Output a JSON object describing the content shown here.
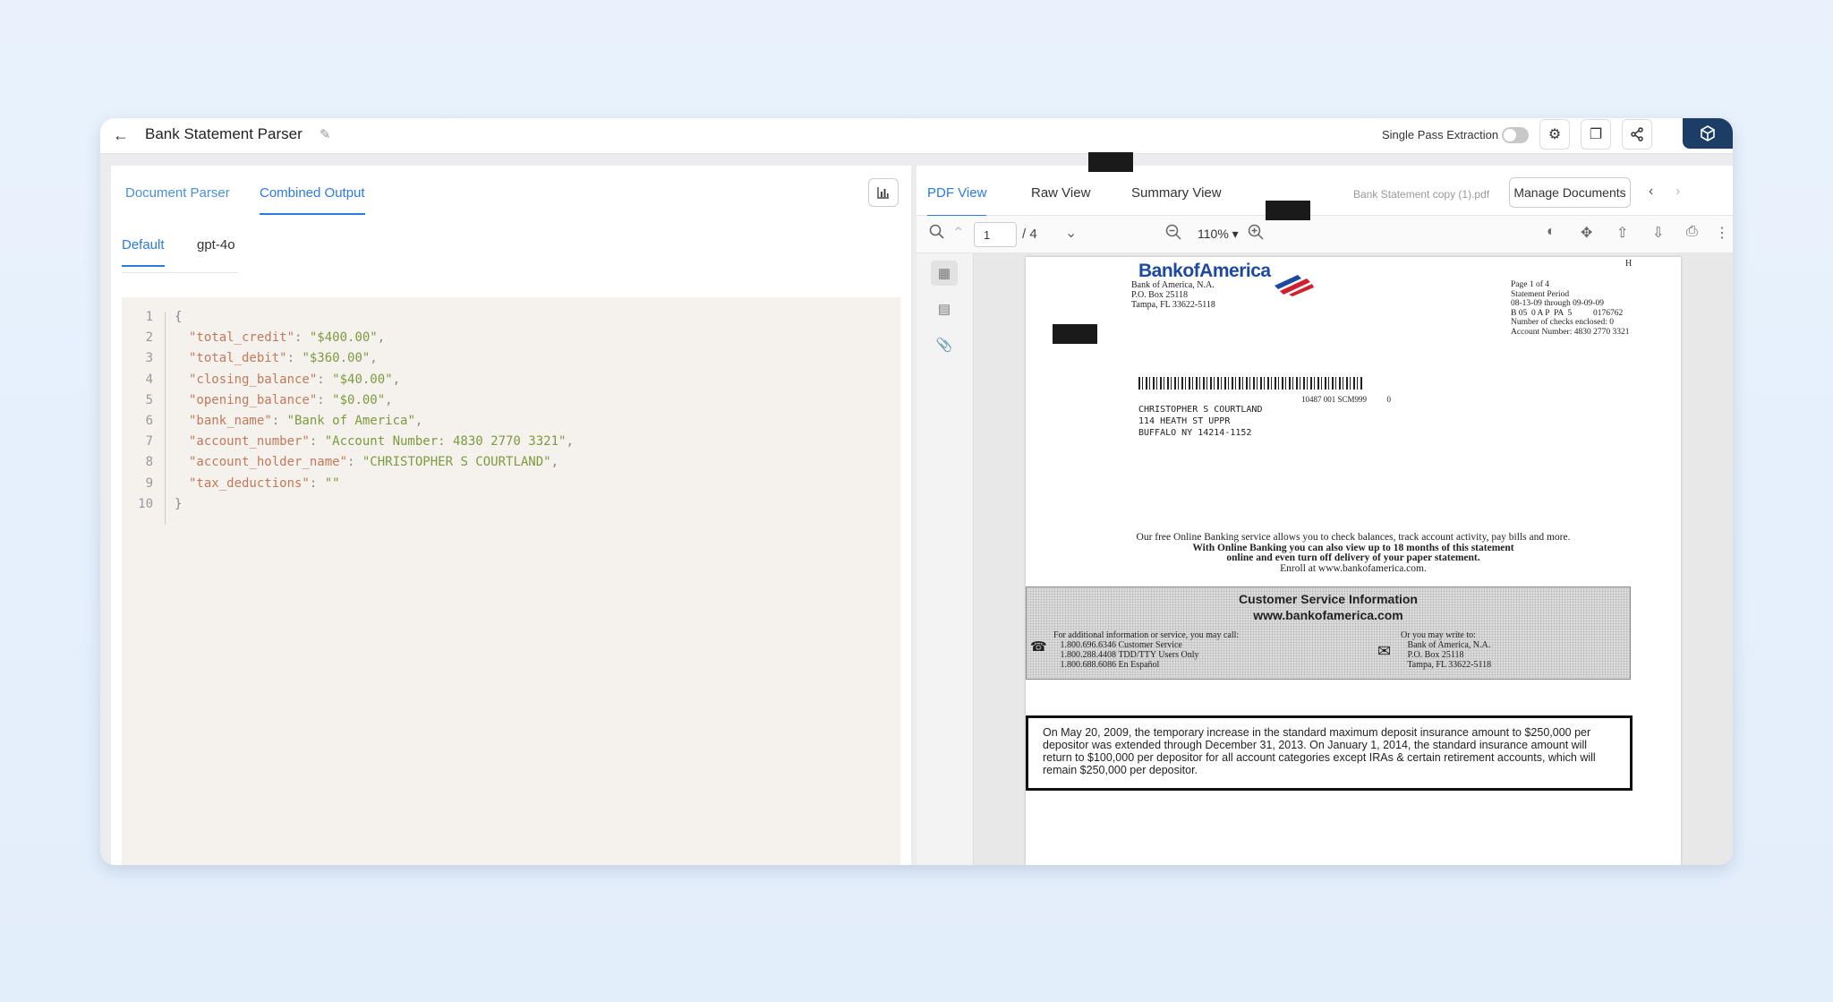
{
  "header": {
    "title": "Bank Statement Parser",
    "single_pass_label": "Single Pass Extraction"
  },
  "left": {
    "tabs": [
      "Document Parser",
      "Combined Output"
    ],
    "subtabs": [
      "Default",
      "gpt-4o"
    ],
    "code_lines": [
      {
        "n": "1",
        "t": "{"
      },
      {
        "n": "2",
        "k": "\"total_credit\"",
        "v": "\"$400.00\"",
        "c": ","
      },
      {
        "n": "3",
        "k": "\"total_debit\"",
        "v": "\"$360.00\"",
        "c": ","
      },
      {
        "n": "4",
        "k": "\"closing_balance\"",
        "v": "\"$40.00\"",
        "c": ","
      },
      {
        "n": "5",
        "k": "\"opening_balance\"",
        "v": "\"$0.00\"",
        "c": ","
      },
      {
        "n": "6",
        "k": "\"bank_name\"",
        "v": "\"Bank of America\"",
        "c": ","
      },
      {
        "n": "7",
        "k": "\"account_number\"",
        "v": "\"Account Number: 4830 2770 3321\"",
        "c": ","
      },
      {
        "n": "8",
        "k": "\"account_holder_name\"",
        "v": "\"CHRISTOPHER S COURTLAND\"",
        "c": ","
      },
      {
        "n": "9",
        "k": "\"tax_deductions\"",
        "v": "\"\"",
        "c": ""
      },
      {
        "n": "10",
        "t": "}"
      }
    ]
  },
  "right": {
    "tabs": [
      "PDF View",
      "Raw View",
      "Summary View"
    ],
    "file_name": "Bank Statement copy (1).pdf",
    "manage_label": "Manage Documents",
    "page_input": "1",
    "page_total": "/ 4",
    "zoom": "110% ▾"
  },
  "doc": {
    "corner": "H",
    "bank_logo": "BankofAmerica",
    "bank_addr": "Bank of America, N.A.\nP.O. Box 25118\nTampa, FL 33622-5118",
    "page_info": "Page 1 of 4\nStatement Period\n08-13-09 through 09-09-09\nB 05  0 A P  PA  5          0176762\nNumber of checks enclosed: 0\nAccount Number: 4830 2770 3321",
    "mail_code": "10487 001 SCM999          0",
    "holder": "CHRISTOPHER S COURTLAND\n114 HEATH ST UPPR\nBUFFALO NY 14214-1152",
    "promo1": "Our free Online Banking service allows you to check balances, track account activity, pay bills and more.",
    "promo2": "With Online Banking you can also view up to 18 months of this statement",
    "promo3": "online and even turn off delivery of your paper statement.",
    "promo4": "Enroll at www.bankofamerica.com.",
    "cs_title": "Customer Service Information",
    "cs_url": "www.bankofamerica.com",
    "cs_call": "For additional information or service, you may call:\n   1.800.696.6346 Customer Service\n   1.800.288.4408 TDD/TTY Users Only\n   1.800.688.6086 En Español",
    "cs_write": "Or you may write to:\n   Bank of America, N.A.\n   P.O. Box 25118\n   Tampa, FL 33622-5118",
    "notice": "On May 20, 2009, the temporary increase in the standard maximum deposit insurance amount to $250,000 per depositor was extended through December 31, 2013. On January 1, 2014, the standard insurance amount will return to $100,000 per depositor for all account categories except IRAs & certain retirement accounts, which will remain $250,000 per depositor."
  }
}
